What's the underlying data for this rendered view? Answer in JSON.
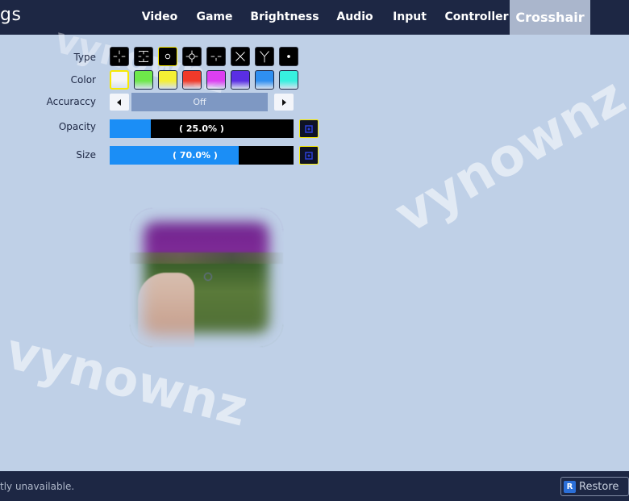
{
  "header": {
    "title": "gs",
    "tabs": [
      {
        "label": "Video"
      },
      {
        "label": "Game"
      },
      {
        "label": "Brightness"
      },
      {
        "label": "Audio"
      },
      {
        "label": "Input"
      },
      {
        "label": "Controller"
      },
      {
        "label": "Crosshair",
        "active": true
      }
    ]
  },
  "crosshair": {
    "type_label": "Type",
    "types": [
      "plus-gap",
      "plus-brackets",
      "circle",
      "circle-plus",
      "t-shape",
      "x-shape",
      "y-shape",
      "dot"
    ],
    "type_selected_index": 2,
    "color_label": "Color",
    "colors": [
      "#f5f5f5",
      "#6ee84a",
      "#f4ef34",
      "#f03a2a",
      "#dc3ff0",
      "#5a2ee4",
      "#2f8ff0",
      "#37f0df"
    ],
    "color_selected_index": 0,
    "accuracy_label": "Accuraccy",
    "accuracy_value": "Off",
    "accuracy_left_icon": "arrow-left-icon",
    "accuracy_right_icon": "arrow-right-icon",
    "opacity_label": "Opacity",
    "opacity_value": 25.0,
    "opacity_text": "( 25.0% )",
    "size_label": "Size",
    "size_value": 70.0,
    "size_text": "( 70.0% )",
    "reset_icon": "reset-icon"
  },
  "watermark": {
    "text": "vynownz"
  },
  "footer": {
    "status": "tly unavailable.",
    "restore_key": "R",
    "restore_label": "Restore"
  },
  "colors": {
    "accent": "#1b8ef6",
    "selection": "#f7e900",
    "topbar": "#1d2744",
    "background": "#bfd0e7"
  }
}
